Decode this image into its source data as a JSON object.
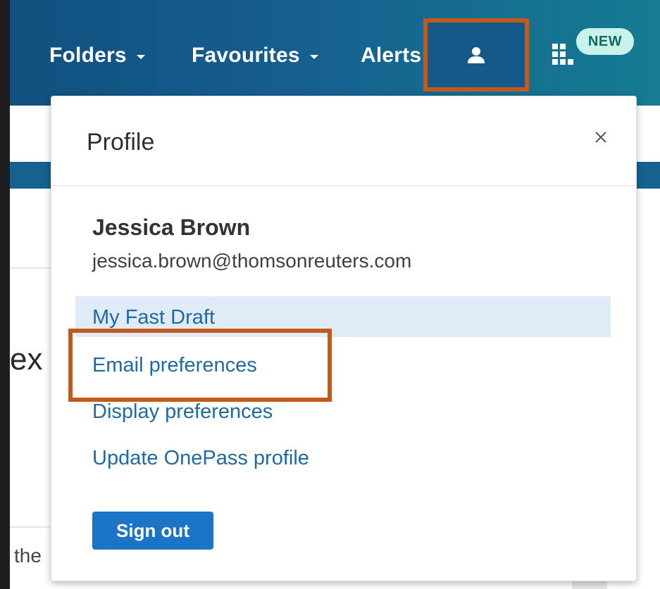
{
  "nav": {
    "folders_label": "Folders",
    "favourites_label": "Favourites",
    "alerts_label": "Alerts",
    "profile_icon": "person-icon",
    "apps_icon": "apps-grid-icon",
    "new_badge": "NEW"
  },
  "profile_panel": {
    "title": "Profile",
    "close_icon": "close-icon",
    "user_name": "Jessica Brown",
    "user_email": "jessica.brown@thomsonreuters.com",
    "menu_items": [
      {
        "label": "My Fast Draft"
      },
      {
        "label": "Email preferences"
      },
      {
        "label": "Display preferences"
      },
      {
        "label": "Update OnePass profile"
      }
    ],
    "sign_out_label": "Sign out"
  },
  "background_page": {
    "heading_fragment": "ex",
    "text_fragment": "the"
  },
  "colors": {
    "header_blue": "#165f8f",
    "link_blue": "#1f6aa5",
    "button_blue": "#1c74c7",
    "highlight_orange": "#c15a1b",
    "selected_row": "#dfebf6",
    "badge_bg": "#c9f3ea"
  }
}
